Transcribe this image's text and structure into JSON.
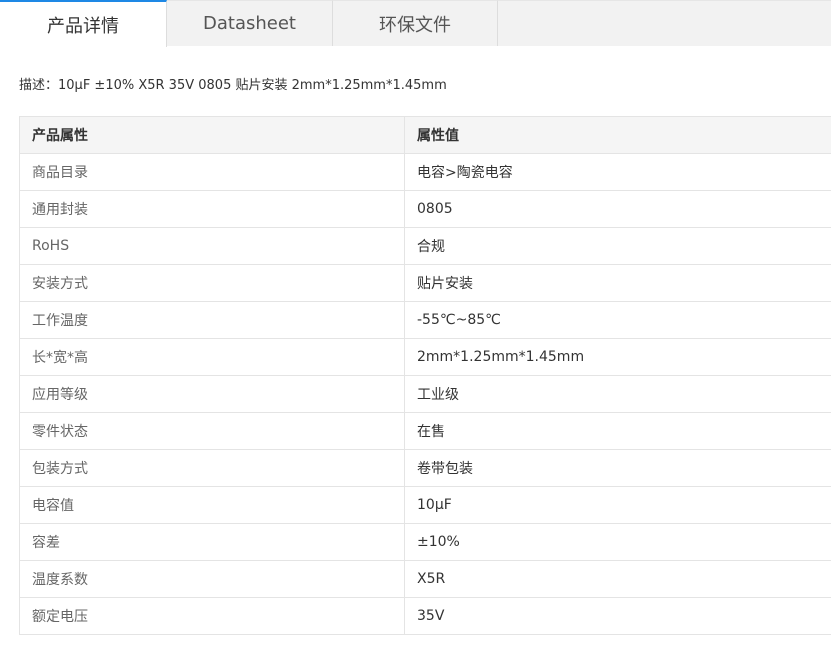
{
  "tabs": [
    {
      "label": "产品详情"
    },
    {
      "label": "Datasheet"
    },
    {
      "label": "环保文件"
    }
  ],
  "description": {
    "text": "描述：10μF ±10% X5R 35V 0805 贴片安装 2mm*1.25mm*1.45mm"
  },
  "table": {
    "headers": {
      "key": "产品属性",
      "value": "属性值"
    },
    "rows": [
      {
        "key": "商品目录",
        "value": "电容>陶瓷电容"
      },
      {
        "key": "通用封装",
        "value": "0805"
      },
      {
        "key": "RoHS",
        "value": "合规"
      },
      {
        "key": "安装方式",
        "value": "贴片安装"
      },
      {
        "key": "工作温度",
        "value": "-55℃~85℃"
      },
      {
        "key": "长*宽*高",
        "value": "2mm*1.25mm*1.45mm"
      },
      {
        "key": "应用等级",
        "value": "工业级"
      },
      {
        "key": "零件状态",
        "value": "在售"
      },
      {
        "key": "包装方式",
        "value": "卷带包装"
      },
      {
        "key": "电容值",
        "value": "10μF"
      },
      {
        "key": "容差",
        "value": "±10%"
      },
      {
        "key": "温度系数",
        "value": "X5R"
      },
      {
        "key": "额定电压",
        "value": "35V"
      }
    ]
  },
  "colors": {
    "active_tab_accent": "#1e88e5",
    "tab_background": "#f2f2f2",
    "header_background": "#f5f5f5",
    "border": "#e4e4e4"
  }
}
